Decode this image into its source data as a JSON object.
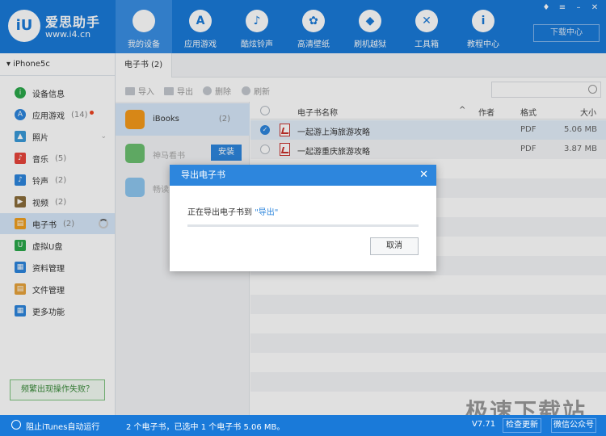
{
  "header": {
    "app_name": "爱思助手",
    "app_url": "www.i4.cn",
    "logo_text": "iU",
    "download_center": "下载中心",
    "window_controls": [
      "shirt-icon",
      "menu-icon",
      "minimize-icon",
      "close-icon"
    ],
    "nav": [
      {
        "label": "我的设备",
        "icon": "apple-icon",
        "glyph": "",
        "active": true
      },
      {
        "label": "应用游戏",
        "icon": "appstore-icon",
        "glyph": "A"
      },
      {
        "label": "酷炫铃声",
        "icon": "bell-icon",
        "glyph": "♪"
      },
      {
        "label": "高清壁纸",
        "icon": "flower-icon",
        "glyph": "✿"
      },
      {
        "label": "刷机越狱",
        "icon": "dropbox-icon",
        "glyph": "◆"
      },
      {
        "label": "工具箱",
        "icon": "tools-icon",
        "glyph": "✕"
      },
      {
        "label": "教程中心",
        "icon": "info-icon",
        "glyph": "i"
      }
    ]
  },
  "sidebar": {
    "device": "iPhone5c",
    "items": [
      {
        "label": "设备信息",
        "count": "",
        "icon": "info-icon",
        "glyph": "i",
        "color": "#2ba84a"
      },
      {
        "label": "应用游戏",
        "count": "(14)",
        "icon": "appstore-icon",
        "glyph": "A",
        "color": "#2d86dd"
      },
      {
        "label": "照片",
        "count": "",
        "icon": "photo-icon",
        "glyph": "▲",
        "color": "#3a9ad9"
      },
      {
        "label": "音乐",
        "count": "(5)",
        "icon": "music-icon",
        "glyph": "♪",
        "color": "#e8453c"
      },
      {
        "label": "铃声",
        "count": "(2)",
        "icon": "bell-icon",
        "glyph": "♪",
        "color": "#2d86dd"
      },
      {
        "label": "视频",
        "count": "(2)",
        "icon": "video-icon",
        "glyph": "▶",
        "color": "#8a6d3b"
      },
      {
        "label": "电子书",
        "count": "(2)",
        "icon": "book-icon",
        "glyph": "▤",
        "color": "#f0a020",
        "active": true
      },
      {
        "label": "虚拟U盘",
        "count": "",
        "icon": "usb-icon",
        "glyph": "U",
        "color": "#2ba84a"
      },
      {
        "label": "资料管理",
        "count": "",
        "icon": "contacts-icon",
        "glyph": "▦",
        "color": "#2d86dd"
      },
      {
        "label": "文件管理",
        "count": "",
        "icon": "folder-icon",
        "glyph": "▤",
        "color": "#e8a33c"
      },
      {
        "label": "更多功能",
        "count": "",
        "icon": "grid-icon",
        "glyph": "▦",
        "color": "#2d86dd"
      }
    ],
    "help_button": "频繁出现操作失败？"
  },
  "content": {
    "tab": "电子书 (2)",
    "toolbar": {
      "import": "导入",
      "export": "导出",
      "delete": "删除",
      "refresh": "刷新"
    },
    "apps": [
      {
        "name": "iBooks",
        "count": "(2)",
        "color": "#f59a1b"
      },
      {
        "name": "神马看书",
        "action": "安装",
        "color": "#6cc070"
      },
      {
        "name": "畅读",
        "color": "#8ec6f0"
      }
    ],
    "columns": {
      "name": "电子书名称",
      "author": "作者",
      "format": "格式",
      "size": "大小"
    },
    "rows": [
      {
        "name": "一起游上海旅游攻略",
        "author": "",
        "format": "PDF",
        "size": "5.06 MB",
        "checked": true
      },
      {
        "name": "一起游重庆旅游攻略",
        "author": "",
        "format": "PDF",
        "size": "3.87 MB",
        "checked": false
      }
    ]
  },
  "dialog": {
    "title": "导出电子书",
    "message": "正在导出电子书到",
    "folder": "\"导出\"",
    "progress": 0,
    "cancel": "取消"
  },
  "status": {
    "itunes": "阻止iTunes自动运行",
    "text": "2 个电子书，已选中 1 个电子书 5.06 MB。",
    "version": "V7.71",
    "check_update": "检查更新",
    "wechat": "微信公众号"
  },
  "watermark": "极速下载站"
}
